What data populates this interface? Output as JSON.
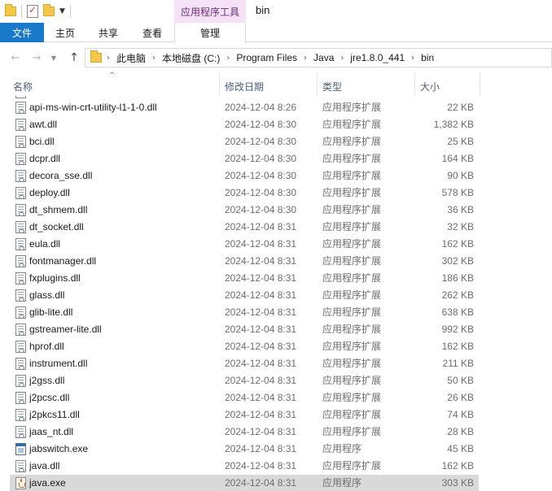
{
  "window": {
    "title": "bin",
    "context_group_label": "应用程序工具"
  },
  "ribbon": {
    "tabs": [
      {
        "label": "文件"
      },
      {
        "label": "主页"
      },
      {
        "label": "共享"
      },
      {
        "label": "查看"
      },
      {
        "label": "管理"
      }
    ]
  },
  "address": {
    "breadcrumbs": [
      {
        "label": "此电脑"
      },
      {
        "label": "本地磁盘 (C:)"
      },
      {
        "label": "Program Files"
      },
      {
        "label": "Java"
      },
      {
        "label": "jre1.8.0_441"
      },
      {
        "label": "bin"
      }
    ]
  },
  "columns": {
    "name": "名称",
    "date": "修改日期",
    "type": "类型",
    "size": "大小"
  },
  "files": [
    {
      "name": "api-ms-win-crt-utility-l1-1-0.dll",
      "date": "2024-12-04 8:26",
      "type": "应用程序扩展",
      "size": "22 KB",
      "icon": "dll-file-icon"
    },
    {
      "name": "awt.dll",
      "date": "2024-12-04 8:30",
      "type": "应用程序扩展",
      "size": "1,382 KB",
      "icon": "dll-file-icon"
    },
    {
      "name": "bci.dll",
      "date": "2024-12-04 8:30",
      "type": "应用程序扩展",
      "size": "25 KB",
      "icon": "dll-file-icon"
    },
    {
      "name": "dcpr.dll",
      "date": "2024-12-04 8:30",
      "type": "应用程序扩展",
      "size": "164 KB",
      "icon": "dll-file-icon"
    },
    {
      "name": "decora_sse.dll",
      "date": "2024-12-04 8:30",
      "type": "应用程序扩展",
      "size": "90 KB",
      "icon": "dll-file-icon"
    },
    {
      "name": "deploy.dll",
      "date": "2024-12-04 8:30",
      "type": "应用程序扩展",
      "size": "578 KB",
      "icon": "dll-file-icon"
    },
    {
      "name": "dt_shmem.dll",
      "date": "2024-12-04 8:30",
      "type": "应用程序扩展",
      "size": "36 KB",
      "icon": "dll-file-icon"
    },
    {
      "name": "dt_socket.dll",
      "date": "2024-12-04 8:31",
      "type": "应用程序扩展",
      "size": "32 KB",
      "icon": "dll-file-icon"
    },
    {
      "name": "eula.dll",
      "date": "2024-12-04 8:31",
      "type": "应用程序扩展",
      "size": "162 KB",
      "icon": "dll-file-icon"
    },
    {
      "name": "fontmanager.dll",
      "date": "2024-12-04 8:31",
      "type": "应用程序扩展",
      "size": "302 KB",
      "icon": "dll-file-icon"
    },
    {
      "name": "fxplugins.dll",
      "date": "2024-12-04 8:31",
      "type": "应用程序扩展",
      "size": "186 KB",
      "icon": "dll-file-icon"
    },
    {
      "name": "glass.dll",
      "date": "2024-12-04 8:31",
      "type": "应用程序扩展",
      "size": "262 KB",
      "icon": "dll-file-icon"
    },
    {
      "name": "glib-lite.dll",
      "date": "2024-12-04 8:31",
      "type": "应用程序扩展",
      "size": "638 KB",
      "icon": "dll-file-icon"
    },
    {
      "name": "gstreamer-lite.dll",
      "date": "2024-12-04 8:31",
      "type": "应用程序扩展",
      "size": "992 KB",
      "icon": "dll-file-icon"
    },
    {
      "name": "hprof.dll",
      "date": "2024-12-04 8:31",
      "type": "应用程序扩展",
      "size": "162 KB",
      "icon": "dll-file-icon"
    },
    {
      "name": "instrument.dll",
      "date": "2024-12-04 8:31",
      "type": "应用程序扩展",
      "size": "211 KB",
      "icon": "dll-file-icon"
    },
    {
      "name": "j2gss.dll",
      "date": "2024-12-04 8:31",
      "type": "应用程序扩展",
      "size": "50 KB",
      "icon": "dll-file-icon"
    },
    {
      "name": "j2pcsc.dll",
      "date": "2024-12-04 8:31",
      "type": "应用程序扩展",
      "size": "26 KB",
      "icon": "dll-file-icon"
    },
    {
      "name": "j2pkcs11.dll",
      "date": "2024-12-04 8:31",
      "type": "应用程序扩展",
      "size": "74 KB",
      "icon": "dll-file-icon"
    },
    {
      "name": "jaas_nt.dll",
      "date": "2024-12-04 8:31",
      "type": "应用程序扩展",
      "size": "28 KB",
      "icon": "dll-file-icon"
    },
    {
      "name": "jabswitch.exe",
      "date": "2024-12-04 8:31",
      "type": "应用程序",
      "size": "45 KB",
      "icon": "exe-file-icon"
    },
    {
      "name": "java.dll",
      "date": "2024-12-04 8:31",
      "type": "应用程序扩展",
      "size": "162 KB",
      "icon": "dll-file-icon"
    },
    {
      "name": "java.exe",
      "date": "2024-12-04 8:31",
      "type": "应用程序",
      "size": "303 KB",
      "icon": "java-exe-icon",
      "selected": true
    }
  ],
  "colors": {
    "file_tab": "#1979ca",
    "context_tab": "#f5e2f7",
    "context_text": "#6b2c78",
    "selected_row": "#d9d9d9",
    "header_text": "#4c607a"
  }
}
